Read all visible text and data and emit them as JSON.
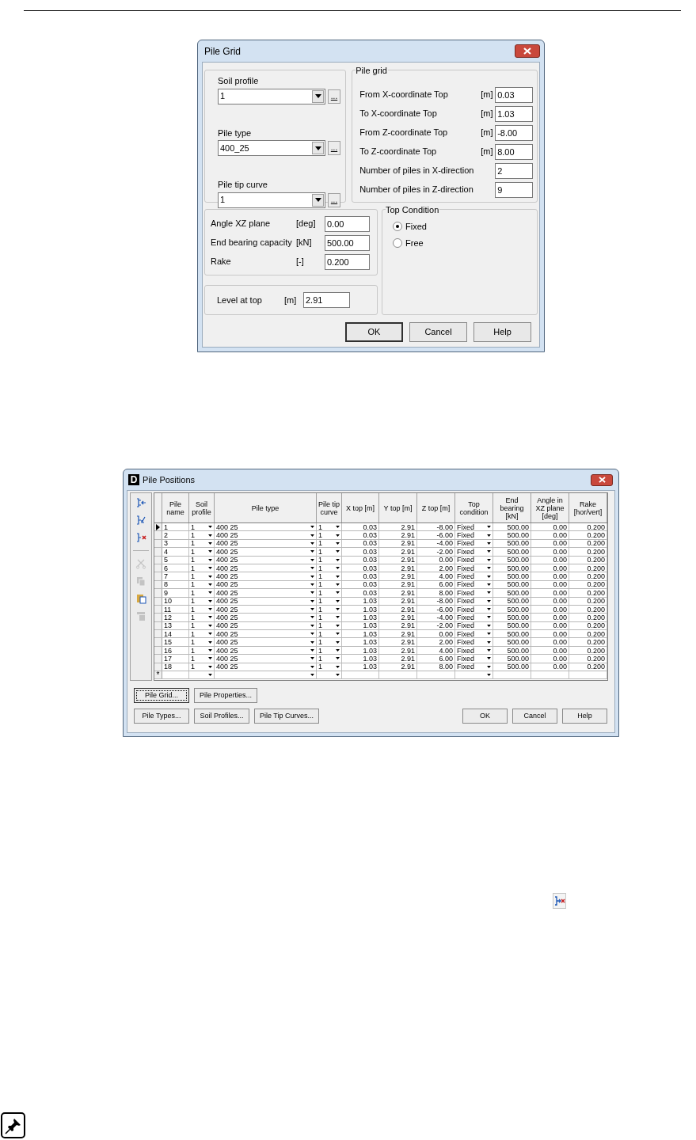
{
  "pile_grid_dialog": {
    "title": "Pile Grid",
    "selectors": [
      {
        "label": "Soil profile",
        "value": "1",
        "browse": "..."
      },
      {
        "label": "Pile type",
        "value": "400_25",
        "browse": "..."
      },
      {
        "label": "Pile tip curve",
        "value": "1",
        "browse": "..."
      }
    ],
    "pile_grid": {
      "title": "Pile grid",
      "fields": [
        {
          "label": "From X-coordinate Top",
          "unit": "[m]",
          "value": "0.03"
        },
        {
          "label": "To X-coordinate Top",
          "unit": "[m]",
          "value": "1.03"
        },
        {
          "label": "From Z-coordinate Top",
          "unit": "[m]",
          "value": "-8.00"
        },
        {
          "label": "To Z-coordinate Top",
          "unit": "[m]",
          "value": "8.00"
        },
        {
          "label": "Number of piles in X-direction",
          "value": "2"
        },
        {
          "label": "Number of piles in Z-direction",
          "value": "9"
        }
      ]
    },
    "properties": [
      {
        "label": "Angle XZ plane",
        "unit": "[deg]",
        "value": "0.00"
      },
      {
        "label": "End bearing capacity",
        "unit": "[kN]",
        "value": "500.00"
      },
      {
        "label": "Rake",
        "unit": "[-]",
        "value": "0.200"
      }
    ],
    "level": {
      "label": "Level at top",
      "unit": "[m]",
      "value": "2.91"
    },
    "top_condition": {
      "title": "Top Condition",
      "options": [
        {
          "label": "Fixed",
          "selected": true
        },
        {
          "label": "Free",
          "selected": false
        }
      ]
    },
    "buttons": [
      {
        "label": "OK",
        "default": true
      },
      {
        "label": "Cancel",
        "default": false
      },
      {
        "label": "Help",
        "default": false
      }
    ]
  },
  "pile_positions_dialog": {
    "title": "Pile Positions",
    "app_icon_letter": "D",
    "toolbar": [
      {
        "kind": "insert-row",
        "disabled": false
      },
      {
        "kind": "add-row",
        "disabled": false
      },
      {
        "kind": "delete-row",
        "disabled": false
      },
      {
        "kind": "separator"
      },
      {
        "kind": "cut",
        "disabled": true
      },
      {
        "kind": "copy",
        "disabled": true
      },
      {
        "kind": "paste",
        "disabled": false
      },
      {
        "kind": "fill-down",
        "disabled": true
      }
    ],
    "columns": [
      {
        "label": "Pile name",
        "kind": "text"
      },
      {
        "label": "Soil profile",
        "kind": "combo"
      },
      {
        "label": "Pile type",
        "kind": "combo"
      },
      {
        "label": "Pile tip curve",
        "kind": "combo"
      },
      {
        "label": "X top [m]",
        "kind": "number"
      },
      {
        "label": "Y top [m]",
        "kind": "number"
      },
      {
        "label": "Z top [m]",
        "kind": "number"
      },
      {
        "label": "Top condition",
        "kind": "combo"
      },
      {
        "label": "End bearing [kN]",
        "kind": "number"
      },
      {
        "label": "Angle in XZ plane [deg]",
        "kind": "number"
      },
      {
        "label": "Rake [hor/vert]",
        "kind": "number"
      }
    ],
    "rows": [
      {
        "kind": "data",
        "current": true,
        "cells": [
          "1",
          "1",
          "400 25",
          "1",
          "0.03",
          "2.91",
          "-8.00",
          "Fixed",
          "500.00",
          "0.00",
          "0.200"
        ]
      },
      {
        "kind": "data",
        "current": false,
        "cells": [
          "2",
          "1",
          "400 25",
          "1",
          "0.03",
          "2.91",
          "-6.00",
          "Fixed",
          "500.00",
          "0.00",
          "0.200"
        ]
      },
      {
        "kind": "data",
        "current": false,
        "cells": [
          "3",
          "1",
          "400 25",
          "1",
          "0.03",
          "2.91",
          "-4.00",
          "Fixed",
          "500.00",
          "0.00",
          "0.200"
        ]
      },
      {
        "kind": "data",
        "current": false,
        "cells": [
          "4",
          "1",
          "400 25",
          "1",
          "0.03",
          "2.91",
          "-2.00",
          "Fixed",
          "500.00",
          "0.00",
          "0.200"
        ]
      },
      {
        "kind": "data",
        "current": false,
        "cells": [
          "5",
          "1",
          "400 25",
          "1",
          "0.03",
          "2.91",
          "0.00",
          "Fixed",
          "500.00",
          "0.00",
          "0.200"
        ]
      },
      {
        "kind": "data",
        "current": false,
        "cells": [
          "6",
          "1",
          "400 25",
          "1",
          "0.03",
          "2.91",
          "2.00",
          "Fixed",
          "500.00",
          "0.00",
          "0.200"
        ]
      },
      {
        "kind": "data",
        "current": false,
        "cells": [
          "7",
          "1",
          "400 25",
          "1",
          "0.03",
          "2.91",
          "4.00",
          "Fixed",
          "500.00",
          "0.00",
          "0.200"
        ]
      },
      {
        "kind": "data",
        "current": false,
        "cells": [
          "8",
          "1",
          "400 25",
          "1",
          "0.03",
          "2.91",
          "6.00",
          "Fixed",
          "500.00",
          "0.00",
          "0.200"
        ]
      },
      {
        "kind": "data",
        "current": false,
        "cells": [
          "9",
          "1",
          "400 25",
          "1",
          "0.03",
          "2.91",
          "8.00",
          "Fixed",
          "500.00",
          "0.00",
          "0.200"
        ]
      },
      {
        "kind": "data",
        "current": false,
        "cells": [
          "10",
          "1",
          "400 25",
          "1",
          "1.03",
          "2.91",
          "-8.00",
          "Fixed",
          "500.00",
          "0.00",
          "0.200"
        ]
      },
      {
        "kind": "data",
        "current": false,
        "cells": [
          "11",
          "1",
          "400 25",
          "1",
          "1.03",
          "2.91",
          "-6.00",
          "Fixed",
          "500.00",
          "0.00",
          "0.200"
        ]
      },
      {
        "kind": "data",
        "current": false,
        "cells": [
          "12",
          "1",
          "400 25",
          "1",
          "1.03",
          "2.91",
          "-4.00",
          "Fixed",
          "500.00",
          "0.00",
          "0.200"
        ]
      },
      {
        "kind": "data",
        "current": false,
        "cells": [
          "13",
          "1",
          "400 25",
          "1",
          "1.03",
          "2.91",
          "-2.00",
          "Fixed",
          "500.00",
          "0.00",
          "0.200"
        ]
      },
      {
        "kind": "data",
        "current": false,
        "cells": [
          "14",
          "1",
          "400 25",
          "1",
          "1.03",
          "2.91",
          "0.00",
          "Fixed",
          "500.00",
          "0.00",
          "0.200"
        ]
      },
      {
        "kind": "data",
        "current": false,
        "cells": [
          "15",
          "1",
          "400 25",
          "1",
          "1.03",
          "2.91",
          "2.00",
          "Fixed",
          "500.00",
          "0.00",
          "0.200"
        ]
      },
      {
        "kind": "data",
        "current": false,
        "cells": [
          "16",
          "1",
          "400 25",
          "1",
          "1.03",
          "2.91",
          "4.00",
          "Fixed",
          "500.00",
          "0.00",
          "0.200"
        ]
      },
      {
        "kind": "data",
        "current": false,
        "cells": [
          "17",
          "1",
          "400 25",
          "1",
          "1.03",
          "2.91",
          "6.00",
          "Fixed",
          "500.00",
          "0.00",
          "0.200"
        ]
      },
      {
        "kind": "data",
        "current": false,
        "cells": [
          "18",
          "1",
          "400 25",
          "1",
          "1.03",
          "2.91",
          "8.00",
          "Fixed",
          "500.00",
          "0.00",
          "0.200"
        ]
      },
      {
        "kind": "new",
        "marker": "*"
      }
    ],
    "upper_buttons": [
      {
        "label": "Pile Grid...",
        "focused": true
      },
      {
        "label": "Pile Properties...",
        "focused": false
      }
    ],
    "lower_buttons": [
      {
        "label": "Pile Types...",
        "focused": false
      },
      {
        "label": "Soil Profiles...",
        "focused": false
      },
      {
        "label": "Pile Tip Curves...",
        "focused": false
      }
    ],
    "dialog_buttons": [
      {
        "label": "OK",
        "focused": false
      },
      {
        "label": "Cancel",
        "focused": false
      },
      {
        "label": "Help",
        "focused": false
      }
    ]
  }
}
